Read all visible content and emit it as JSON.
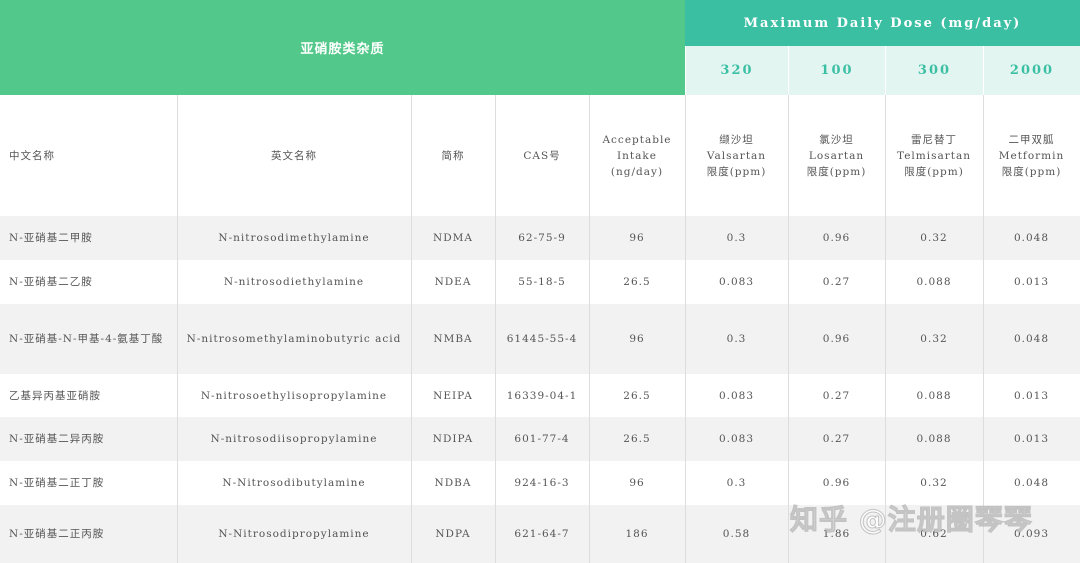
{
  "header": {
    "group_title": "亚硝胺类杂质",
    "max_dose_title": "Maximum Daily Dose (mg/day)",
    "doses": [
      "320",
      "100",
      "300",
      "2000"
    ]
  },
  "columns": [
    "中文名称",
    "英文名称",
    "简称",
    "CAS号",
    "Acceptable\nIntake\n(ng/day)",
    "缬沙坦\nValsartan\n限度(ppm)",
    "氯沙坦\nLosartan\n限度(ppm)",
    "雷尼替丁\nTelmisartan\n限度(ppm)",
    "二甲双胍\nMetformin\n限度(ppm)"
  ],
  "rows": [
    [
      "N-亚硝基二甲胺",
      "N-nitrosodimethylamine",
      "NDMA",
      "62-75-9",
      "96",
      "0.3",
      "0.96",
      "0.32",
      "0.048"
    ],
    [
      "N-亚硝基二乙胺",
      "N-nitrosodiethylamine",
      "NDEA",
      "55-18-5",
      "26.5",
      "0.083",
      "0.27",
      "0.088",
      "0.013"
    ],
    [
      "N-亚硝基-N-甲基-4-氨基丁酸",
      "N-nitrosomethylaminobutyric acid",
      "NMBA",
      "61445-55-4",
      "96",
      "0.3",
      "0.96",
      "0.32",
      "0.048"
    ],
    [
      "乙基异丙基亚硝胺",
      "N-nitrosoethylisopropylamine",
      "NEIPA",
      "16339-04-1",
      "26.5",
      "0.083",
      "0.27",
      "0.088",
      "0.013"
    ],
    [
      "N-亚硝基二异丙胺",
      "N-nitrosodiisopropylamine",
      "NDIPA",
      "601-77-4",
      "26.5",
      "0.083",
      "0.27",
      "0.088",
      "0.013"
    ],
    [
      "N-亚硝基二正丁胺",
      "N-Nitrosodibutylamine",
      "NDBA",
      "924-16-3",
      "96",
      "0.3",
      "0.96",
      "0.32",
      "0.048"
    ],
    [
      "N-亚硝基二正丙胺",
      "N-Nitrosodipropylamine",
      "NDPA",
      "621-64-7",
      "186",
      "0.58",
      "1.86",
      "0.62",
      "0.093"
    ]
  ],
  "watermark": "知乎 @注册圈琴琴",
  "colors": {
    "green": "#52c98a",
    "teal": "#3bbfa3",
    "light_teal": "#e2f5f1",
    "stripe": "#f2f2f2"
  }
}
